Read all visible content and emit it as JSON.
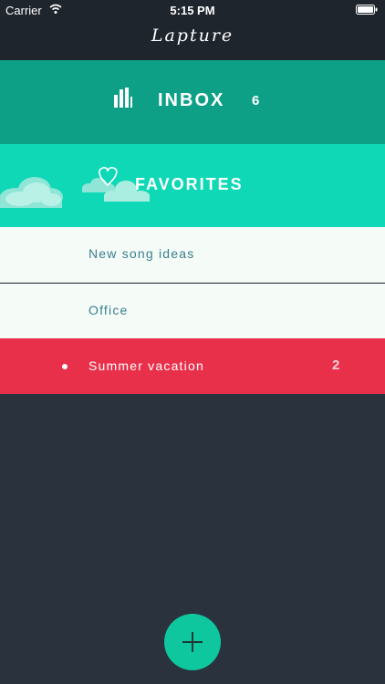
{
  "status_bar": {
    "carrier": "Carrier",
    "time": "5:15 PM"
  },
  "app": {
    "title": "Lapture"
  },
  "inbox": {
    "label": "INBOX",
    "count": "6",
    "icon": "bar-chart-icon"
  },
  "favorites": {
    "label": "FAVORITES",
    "icon": "heart-icon"
  },
  "lists": [
    {
      "label": "New song ideas"
    },
    {
      "label": "Office"
    },
    {
      "label": "Summer vacation",
      "count": "2"
    }
  ],
  "colors": {
    "inbox": "#0ea087",
    "favorites": "#0fd8b6",
    "selected": "#e9304b",
    "background": "#2a323d"
  },
  "fab": {
    "icon": "plus-icon"
  }
}
